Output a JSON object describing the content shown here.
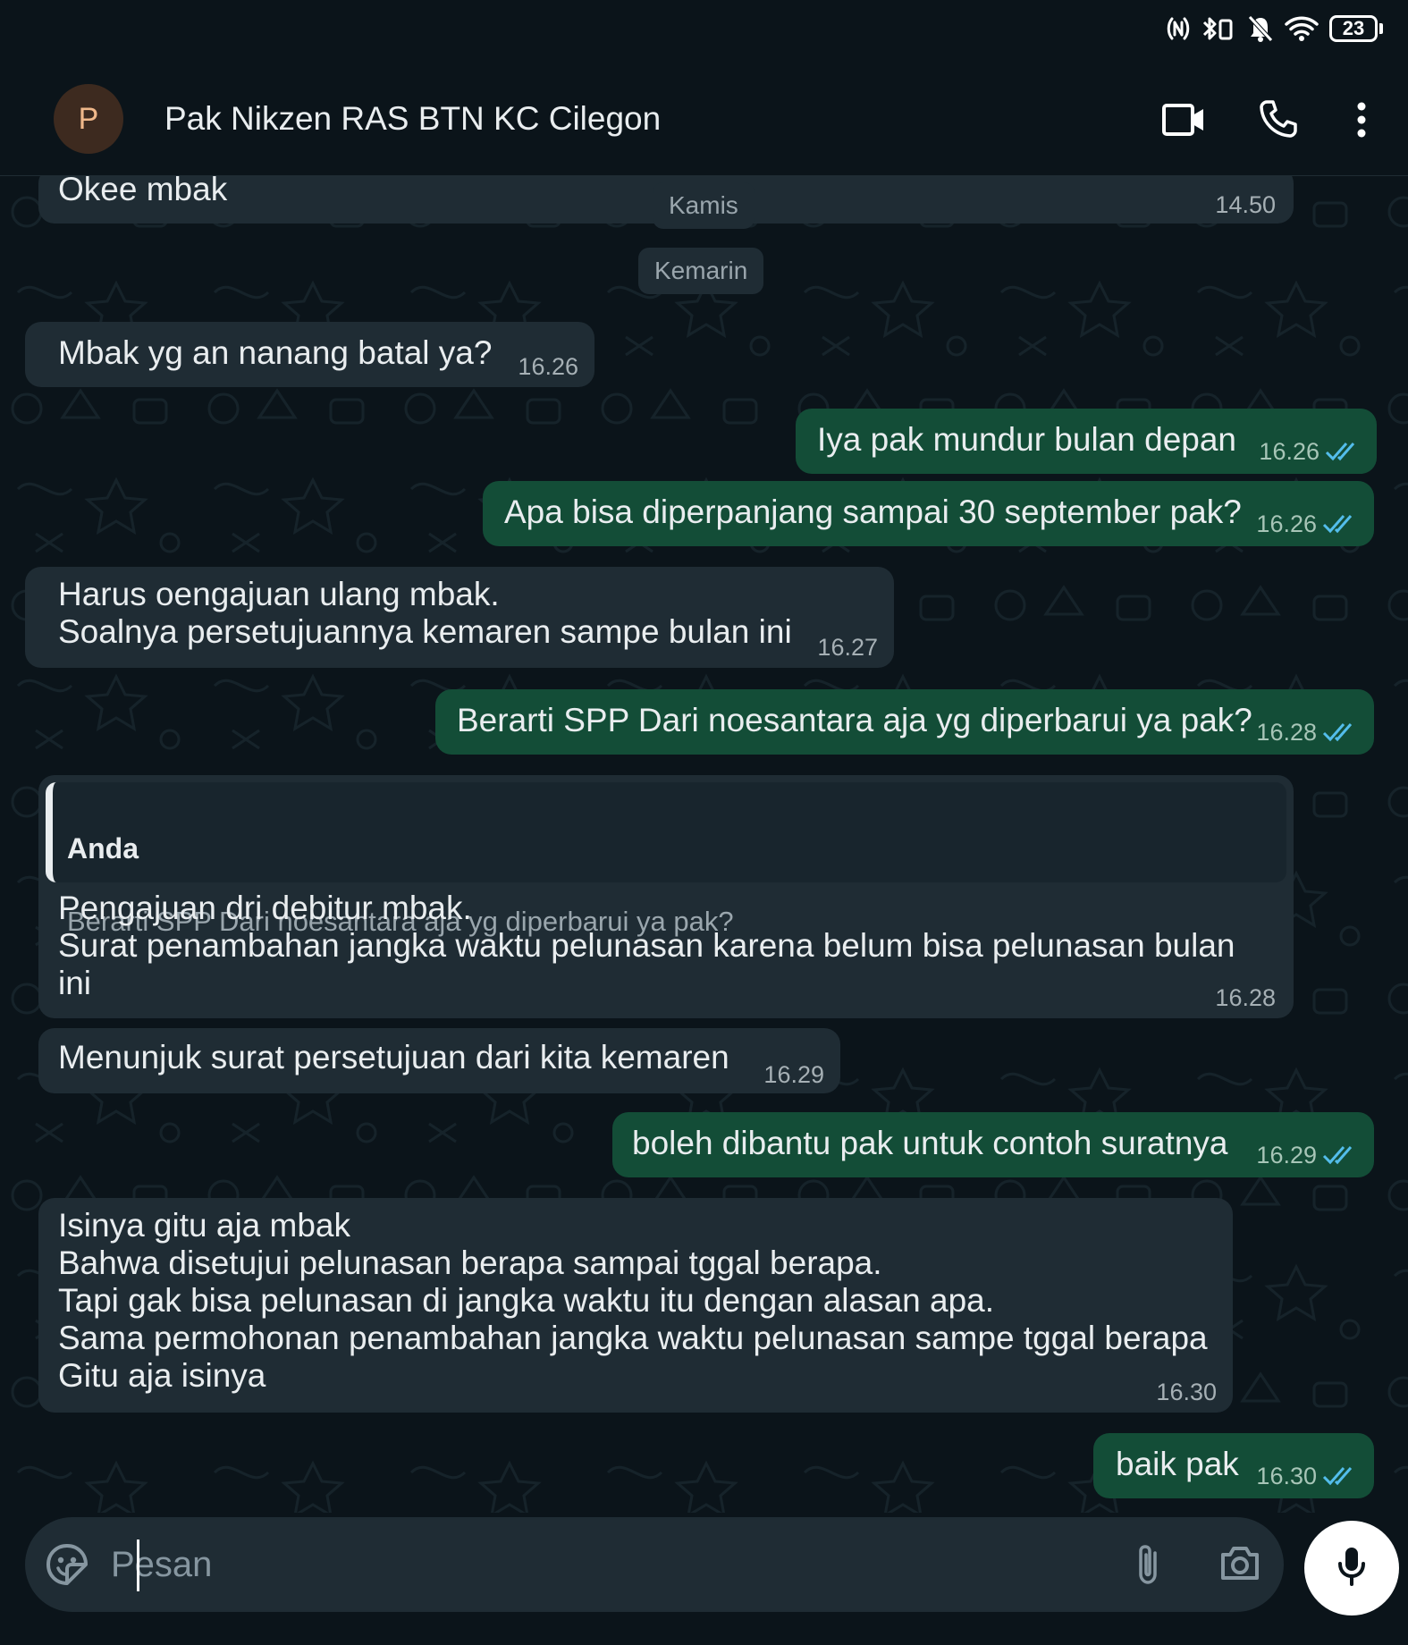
{
  "status_bar": {
    "battery": "23",
    "icons": [
      "nfc-icon",
      "bluetooth-vibrate-icon",
      "bell-off-icon",
      "wifi-icon",
      "battery-icon"
    ]
  },
  "header": {
    "avatar_letter": "P",
    "contact_name": "Pak Nikzen RAS BTN KC Cilegon",
    "icons": [
      "video-call-icon",
      "voice-call-icon",
      "more-options-icon"
    ]
  },
  "date_chips": {
    "kamis": "Kamis",
    "kemarin": "Kemarin"
  },
  "messages": [
    {
      "direction": "in",
      "text": "Okee mbak",
      "time": "14.50"
    },
    {
      "direction": "in",
      "text": "Mbak yg an nanang batal ya?",
      "time": "16.26"
    },
    {
      "direction": "out",
      "text": "Iya pak mundur bulan depan",
      "time": "16.26",
      "status": "read"
    },
    {
      "direction": "out",
      "text": "Apa bisa diperpanjang sampai 30 september pak?",
      "time": "16.26",
      "status": "read"
    },
    {
      "direction": "in",
      "text": "Harus oengajuan ulang mbak.\nSoalnya persetujuannya kemaren sampe bulan ini",
      "time": "16.27"
    },
    {
      "direction": "out",
      "text": "Berarti SPP Dari noesantara aja yg diperbarui ya pak?",
      "time": "16.28",
      "status": "read"
    },
    {
      "direction": "in",
      "reply_to": {
        "author": "Anda",
        "text": "Berarti SPP Dari noesantara aja yg diperbarui ya pak?"
      },
      "text": "Pengajuan dri debitur mbak.\nSurat penambahan jangka waktu pelunasan karena belum bisa pelunasan bulan\nini",
      "time": "16.28"
    },
    {
      "direction": "in",
      "text": "Menunjuk surat persetujuan dari kita kemaren",
      "time": "16.29"
    },
    {
      "direction": "out",
      "text": "boleh dibantu pak untuk contoh suratnya",
      "time": "16.29",
      "status": "read"
    },
    {
      "direction": "in",
      "text": "Isinya gitu aja mbak\nBahwa disetujui pelunasan berapa sampai tggal berapa.\nTapi gak bisa pelunasan di jangka waktu itu dengan alasan apa.\nSama permohonan penambahan jangka waktu pelunasan sampe tggal berapa\nGitu aja isinya",
      "time": "16.30"
    },
    {
      "direction": "out",
      "text": "baik pak",
      "time": "16.30",
      "status": "read"
    }
  ],
  "input": {
    "placeholder": "Pesan",
    "value": ""
  },
  "colors": {
    "background": "#0b141a",
    "incoming_bubble": "#1f2c34",
    "outgoing_bubble": "#134d37",
    "read_tick": "#53bdeb",
    "text": "#e9edef",
    "meta_text": "#a6b0b5"
  }
}
